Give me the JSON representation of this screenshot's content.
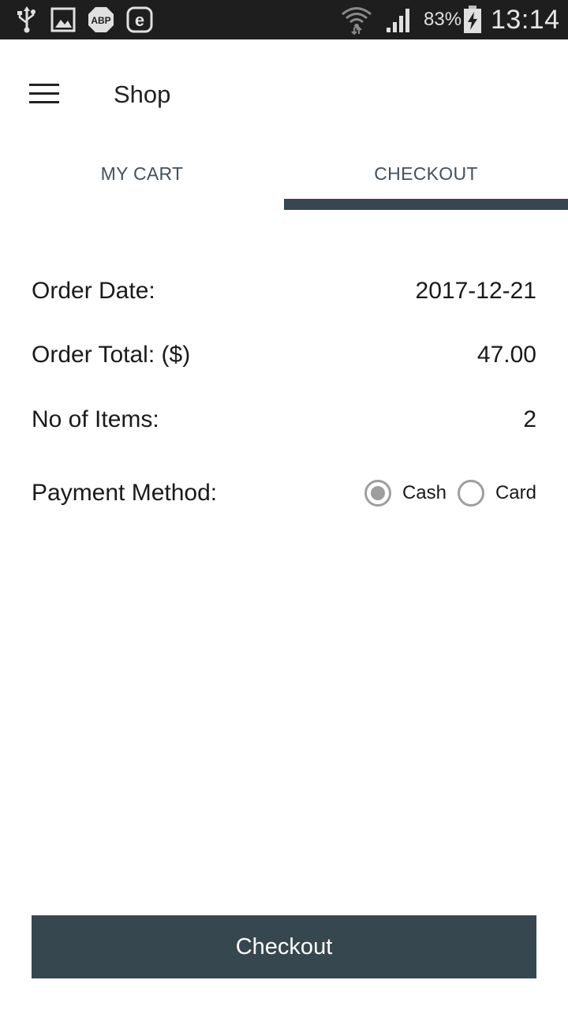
{
  "status_bar": {
    "battery_percent": "83%",
    "time": "13:14",
    "icons": [
      "usb-icon",
      "gallery-icon",
      "adblock-plus-icon",
      "e-icon",
      "wifi-icon",
      "cell-signal-icon",
      "battery-charging-icon"
    ],
    "icon_labels": {
      "abp": "ABP",
      "e": "e"
    }
  },
  "app_bar": {
    "title": "Shop",
    "menu_icon": "hamburger-menu-icon"
  },
  "tabs": [
    {
      "label": "MY CART",
      "selected": false
    },
    {
      "label": "CHECKOUT",
      "selected": true
    }
  ],
  "checkout": {
    "order_date_label": "Order Date:",
    "order_date_value": "2017-12-21",
    "order_total_label": "Order Total: ($)",
    "order_total_value": "47.00",
    "items_label": "No of Items:",
    "items_value": "2",
    "payment_label": "Payment Method:",
    "payment_options": [
      {
        "label": "Cash",
        "selected": true
      },
      {
        "label": "Card",
        "selected": false
      }
    ],
    "button_label": "Checkout"
  },
  "colors": {
    "primary": "#37474f",
    "status_bar": "#1e1e1e",
    "radio": "#9e9e9e",
    "tab_text": "#44515b"
  }
}
